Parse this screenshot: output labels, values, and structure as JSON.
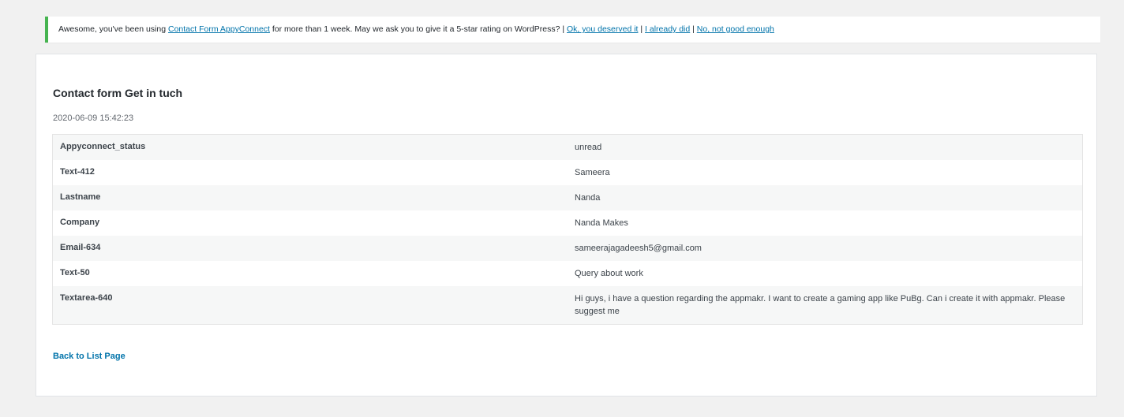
{
  "notice": {
    "text_before": "Awesome, you've been using ",
    "plugin_link": "Contact Form AppyConnect",
    "text_middle": " for more than 1 week. May we ask you to give it a 5-star rating on WordPress? | ",
    "link_ok": "Ok, you deserved it",
    "sep1": " | ",
    "link_already": "I already did",
    "sep2": " | ",
    "link_no": "No, not good enough",
    "accent_color": "#46b450"
  },
  "entry": {
    "title": "Contact form Get in tuch",
    "date": "2020-06-09 15:42:23",
    "fields": [
      {
        "label": "Appyconnect_status",
        "value": "unread"
      },
      {
        "label": "Text-412",
        "value": "Sameera"
      },
      {
        "label": "Lastname",
        "value": "Nanda"
      },
      {
        "label": "Company",
        "value": "Nanda Makes"
      },
      {
        "label": "Email-634",
        "value": "sameerajagadeesh5@gmail.com"
      },
      {
        "label": "Text-50",
        "value": "Query about work"
      },
      {
        "label": "Textarea-640",
        "value": "Hi guys, i have a question regarding the appmakr. I want to create a gaming app like PuBg. Can i create it with appmakr. Please suggest me"
      }
    ]
  },
  "footer": {
    "back_link": "Back to List Page"
  }
}
